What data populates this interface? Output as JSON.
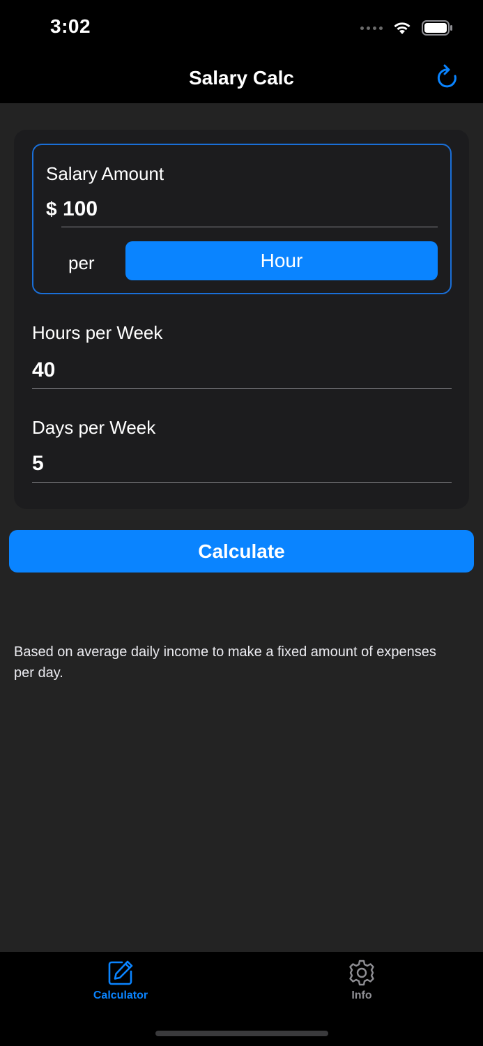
{
  "status_bar": {
    "time": "3:02"
  },
  "nav": {
    "title": "Salary Calc",
    "refresh_icon": "refresh-icon"
  },
  "salary": {
    "label": "Salary Amount",
    "currency": "$",
    "amount": "100",
    "per_label": "per",
    "period": "Hour"
  },
  "hours": {
    "label": "Hours per Week",
    "value": "40"
  },
  "days": {
    "label": "Days per Week",
    "value": "5"
  },
  "calculate_label": "Calculate",
  "note": "Based on average daily income to make a fixed amount of expenses per day.",
  "tabs": [
    {
      "label": "Calculator",
      "icon": "pencil-square-icon",
      "selected": true
    },
    {
      "label": "Info",
      "icon": "gear-icon",
      "selected": false
    }
  ],
  "colors": {
    "accent": "#0a84ff",
    "background": "#232323",
    "card": "#1c1c1e",
    "bar": "#000000"
  }
}
